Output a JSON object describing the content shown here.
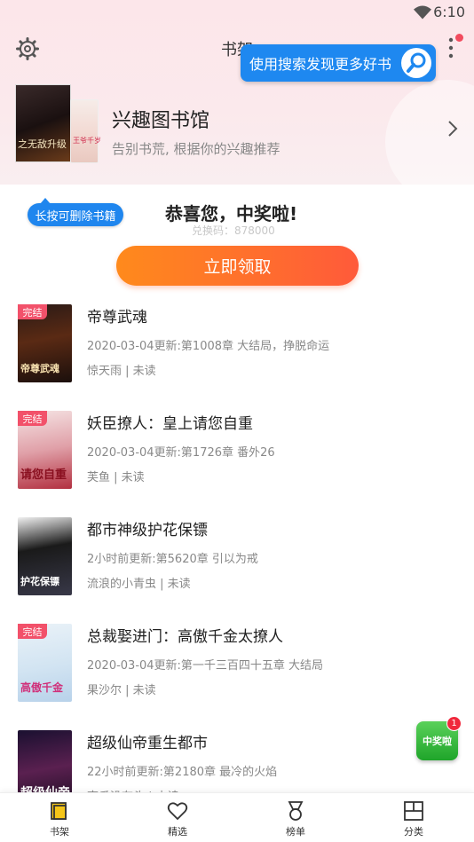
{
  "status_bar": {
    "time": "6:10"
  },
  "header": {
    "title": "书架",
    "search_label": "使用搜索发现更多好书"
  },
  "banner": {
    "title": "兴趣图书馆",
    "subtitle": "告别书荒, 根据你的兴趣推荐",
    "cover_text_1": "之无敌升级",
    "cover_text_2": "王爷千岁"
  },
  "tip": {
    "label": "长按可删除书籍"
  },
  "prize": {
    "title": "恭喜您，中奖啦!",
    "code": "兑换码：878000",
    "claim_label": "立即领取"
  },
  "books": [
    {
      "title": "帝尊武魂",
      "update": "2020-03-04更新:第1008章 大结局，挣脱命运",
      "meta": "惊天雨 | 未读",
      "completed": true,
      "cover_text": "帝尊武魂"
    },
    {
      "title": "妖臣撩人：皇上请您自重",
      "update": "2020-03-04更新:第1726章  番外26",
      "meta": "芙鱼 | 未读",
      "completed": true,
      "cover_text": "请您自重"
    },
    {
      "title": "都市神级护花保镖",
      "update": "2小时前更新:第5620章      引以为戒",
      "meta": "流浪的小青虫 | 未读",
      "completed": false,
      "cover_text": "护花保镖"
    },
    {
      "title": "总裁娶进门：高傲千金太撩人",
      "update": "2020-03-04更新:第一千三百四十五章   大结局",
      "meta": "果沙尔 | 未读",
      "completed": true,
      "cover_text": "高傲千金"
    },
    {
      "title": "超级仙帝重生都市",
      "update": "22小时前更新:第2180章 最冷的火焰",
      "meta": "南瓜没有头 | 未读",
      "completed": false,
      "cover_text": "超级仙帝"
    }
  ],
  "book_labels": {
    "completed_tag": "完结"
  },
  "floating": {
    "label": "中奖啦",
    "count": "1"
  },
  "bottom_nav": [
    {
      "label": "书架",
      "icon": "bookshelf-icon",
      "active": true
    },
    {
      "label": "精选",
      "icon": "heart-icon",
      "active": false
    },
    {
      "label": "榜单",
      "icon": "medal-icon",
      "active": false
    },
    {
      "label": "分类",
      "icon": "category-icon",
      "active": false
    }
  ],
  "colors": {
    "accent_blue": "#1e88f0",
    "claim_orange": "#ff7a24",
    "done_tag": "#f2516a",
    "prize_green": "#1fa52a"
  }
}
